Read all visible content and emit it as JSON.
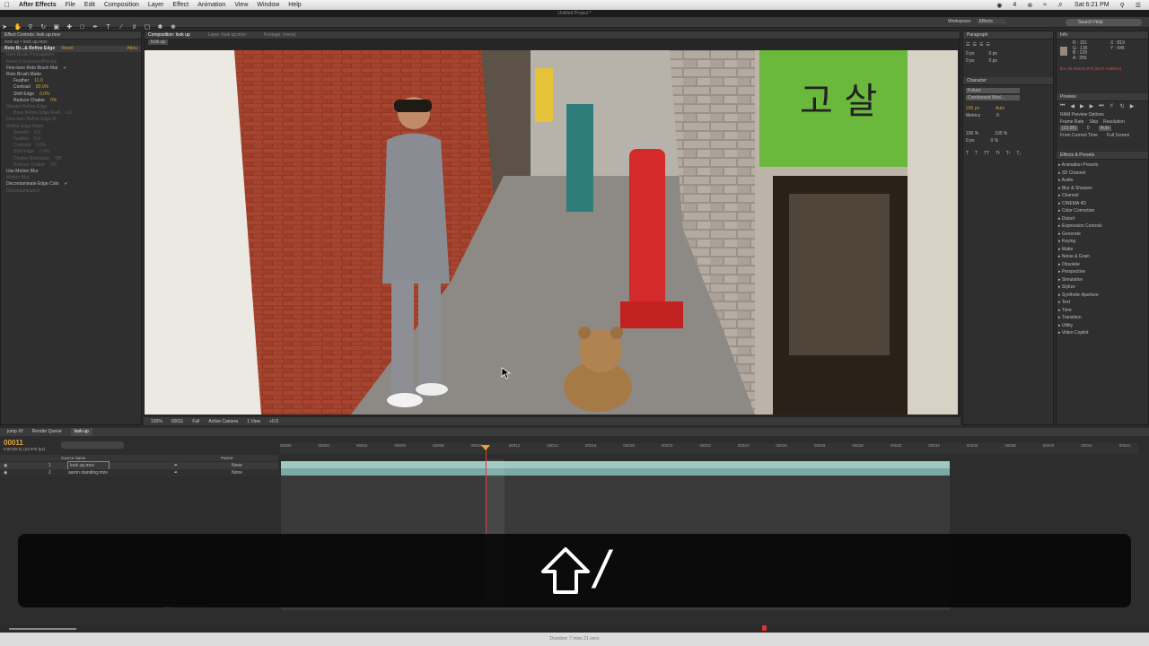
{
  "menubar": {
    "app_name": "After Effects",
    "items": [
      "File",
      "Edit",
      "Composition",
      "Layer",
      "Effect",
      "Animation",
      "View",
      "Window",
      "Help"
    ],
    "clock": "Sat 6:21 PM",
    "battery_num": "4"
  },
  "title": "Untitled Project *",
  "workspace": {
    "label": "Workspace:",
    "value": "Effects"
  },
  "search_help": "Search Help",
  "effect_controls": {
    "tab": "Effect Controls: look up.mov",
    "sub": "look up • look up.mov",
    "effect_name": "Roto Br...& Refine Edge",
    "reset": "Reset",
    "about": "Abou",
    "rows": [
      {
        "label": "Roto Brush Propagation",
        "dim": true
      },
      {
        "label": "Invert Foreground/Backgr",
        "dim": true
      },
      {
        "label": "Fine-tune Roto Brush Mat",
        "dim": false,
        "check": "✔"
      },
      {
        "label": "Roto Brush Matte",
        "dim": false
      },
      {
        "label": "Feather",
        "value": "11.0",
        "dim": false
      },
      {
        "label": "Contrast",
        "value": "80.0%",
        "dim": false
      },
      {
        "label": "Shift Edge",
        "value": "0.0%",
        "dim": false
      },
      {
        "label": "Reduce Chatter",
        "value": "0%",
        "dim": false
      },
      {
        "label": "Render Refine Edge",
        "dim": true
      },
      {
        "label": "Base Refine Edge Radi",
        "value": "0.0",
        "dim": true
      },
      {
        "label": "Fine-tune Refine Edge M",
        "dim": true
      },
      {
        "label": "Refine Edge Matte",
        "dim": true
      },
      {
        "label": "Smooth",
        "value": "0.0",
        "dim": true
      },
      {
        "label": "Feather",
        "value": "0.0",
        "dim": true
      },
      {
        "label": "Contrast",
        "value": "0.0%",
        "dim": true
      },
      {
        "label": "Shift Edge",
        "value": "0.0%",
        "dim": true
      },
      {
        "label": "Chatter Reduction",
        "value": "Off",
        "dim": true
      },
      {
        "label": "Reduce Chatter",
        "value": "0%",
        "dim": true
      },
      {
        "label": "Use Motion Blur",
        "dim": false
      },
      {
        "label": "Motion Blur",
        "dim": true
      },
      {
        "label": "Decontaminate Edge Colo",
        "dim": false,
        "check": "✔"
      },
      {
        "label": "Decontamination",
        "dim": true
      }
    ]
  },
  "composition": {
    "tab": "Composition: look up",
    "layer_tab": "Layer: look up.mov",
    "footage_tab": "Footage: (none)",
    "sub": "look up",
    "sign_text": "고  살",
    "bottom": [
      "100%",
      "00011",
      "Full",
      "Active Camera",
      "1 View",
      "+0.0"
    ]
  },
  "paragraph": {
    "tab": "Paragraph",
    "indent": [
      "0 px",
      "0 px",
      "0 px",
      "0 px",
      "0 px"
    ]
  },
  "character": {
    "tab": "Character",
    "font": "Futura",
    "style": "Condensed Med...",
    "size": "206 px",
    "leading": "Auto",
    "kern": "Metrics",
    "track": "0",
    "vscale": "100 %",
    "hscale": "100 %",
    "baseline": "0 px",
    "tsume": "0 %"
  },
  "info": {
    "tab": "Info",
    "r": "R : 151",
    "g": "G : 136",
    "b": "B : 128",
    "a": "A : 255",
    "x": "X : 819",
    "y": "Y : 945",
    "fps_note": "fps: 06.053/23.976 (NOT realtime)"
  },
  "preview": {
    "tab": "Preview",
    "options": "RAM Preview Options",
    "frame_rate": "Frame Rate",
    "skip": "Skip",
    "resolution": "Resolution",
    "fr_val": "(23.98)",
    "skip_val": "0",
    "res_val": "Auto",
    "from_current": "From Current Time",
    "full_screen": "Full Screen"
  },
  "effects_presets": {
    "tab": "Effects & Presets",
    "items": [
      "Animation Presets",
      "3D Channel",
      "Audio",
      "Blur & Sharpen",
      "Channel",
      "CINEMA 4D",
      "Color Correction",
      "Distort",
      "Expression Controls",
      "Generate",
      "Keying",
      "Matte",
      "Noise & Grain",
      "Obsolete",
      "Perspective",
      "Simulation",
      "Stylize",
      "Synthetic Aperture",
      "Text",
      "Time",
      "Transition",
      "Utility",
      "Video Copilot"
    ]
  },
  "timeline": {
    "tabs": [
      "jump #2",
      "Render Queue",
      "look up"
    ],
    "timecode": "00011",
    "fps": "0:00:00:11 (23.976 fps)",
    "col_source": "Source Name",
    "col_parent": "Parent",
    "layers": [
      {
        "num": "1",
        "name": "look up.mov",
        "parent": "None"
      },
      {
        "num": "2",
        "name": "aaron standing.mov",
        "parent": "None"
      }
    ],
    "ruler": [
      "00000",
      "00002",
      "00004",
      "00006",
      "00008",
      "00010",
      "00012",
      "00014",
      "00016",
      "00018",
      "00020",
      "00022",
      "00024",
      "00026",
      "00028",
      "00030",
      "00032",
      "00034",
      "00036",
      "00038",
      "00040",
      "00042",
      "00044"
    ],
    "toggle_label": "Toggle Switches / Modes"
  },
  "shortcut_overlay": {
    "key_symbol": "shift-icon",
    "slash": "/"
  },
  "status": {
    "duration": "Duration: 7 mins 21 secs"
  }
}
